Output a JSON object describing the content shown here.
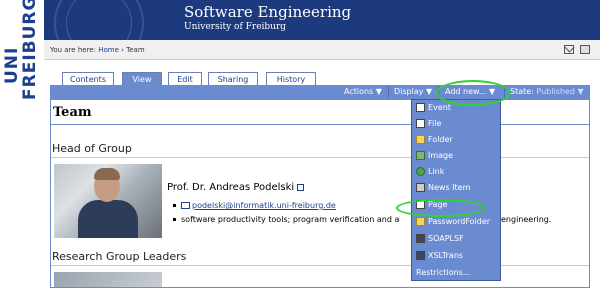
{
  "brand": {
    "line1": "UNI",
    "line2": "FREIBURG"
  },
  "header": {
    "title": "Software Engineering",
    "subtitle": "University of Freiburg"
  },
  "breadcrumb": {
    "prefix": "You are here:",
    "home": "Home",
    "separator": "›",
    "current": "Team"
  },
  "tabs": [
    {
      "label": "Contents",
      "active": false
    },
    {
      "label": "View",
      "active": true
    },
    {
      "label": "Edit",
      "active": false
    },
    {
      "label": "Sharing",
      "active": false
    },
    {
      "label": "History",
      "active": false
    }
  ],
  "actionbar": {
    "actions": "Actions ▼",
    "display": "Display ▼",
    "add_new": "Add new... ▼",
    "state_label": "State:",
    "state_value": "Published ▼"
  },
  "page": {
    "title": "Team",
    "head_section": "Head of Group",
    "person": {
      "name": "Prof. Dr. Andreas Podelski",
      "email": "podelski@informatik.uni-freiburg.de",
      "interests": "software productivity tools; program verification and a"
    },
    "interests_tail": "engineering.",
    "leaders_section": "Research Group Leaders"
  },
  "add_menu": {
    "items": [
      {
        "label": "Event",
        "icon": "event-icon"
      },
      {
        "label": "File",
        "icon": "file-icon"
      },
      {
        "label": "Folder",
        "icon": "folder-icon"
      },
      {
        "label": "Image",
        "icon": "image-icon"
      },
      {
        "label": "Link",
        "icon": "link-icon"
      },
      {
        "label": "News Item",
        "icon": "news-icon"
      },
      {
        "label": "Page",
        "icon": "page-icon"
      },
      {
        "label": "PasswordFolder",
        "icon": "password-folder-icon"
      },
      {
        "label": "SOAPLSF",
        "icon": "soap-icon"
      },
      {
        "label": "XSLTrans",
        "icon": "xsl-icon"
      },
      {
        "label": "Restrictions...",
        "icon": ""
      }
    ]
  },
  "colors": {
    "header": "#1d3a7f",
    "accent": "#6b8bd1",
    "highlight": "#2fd32f"
  }
}
